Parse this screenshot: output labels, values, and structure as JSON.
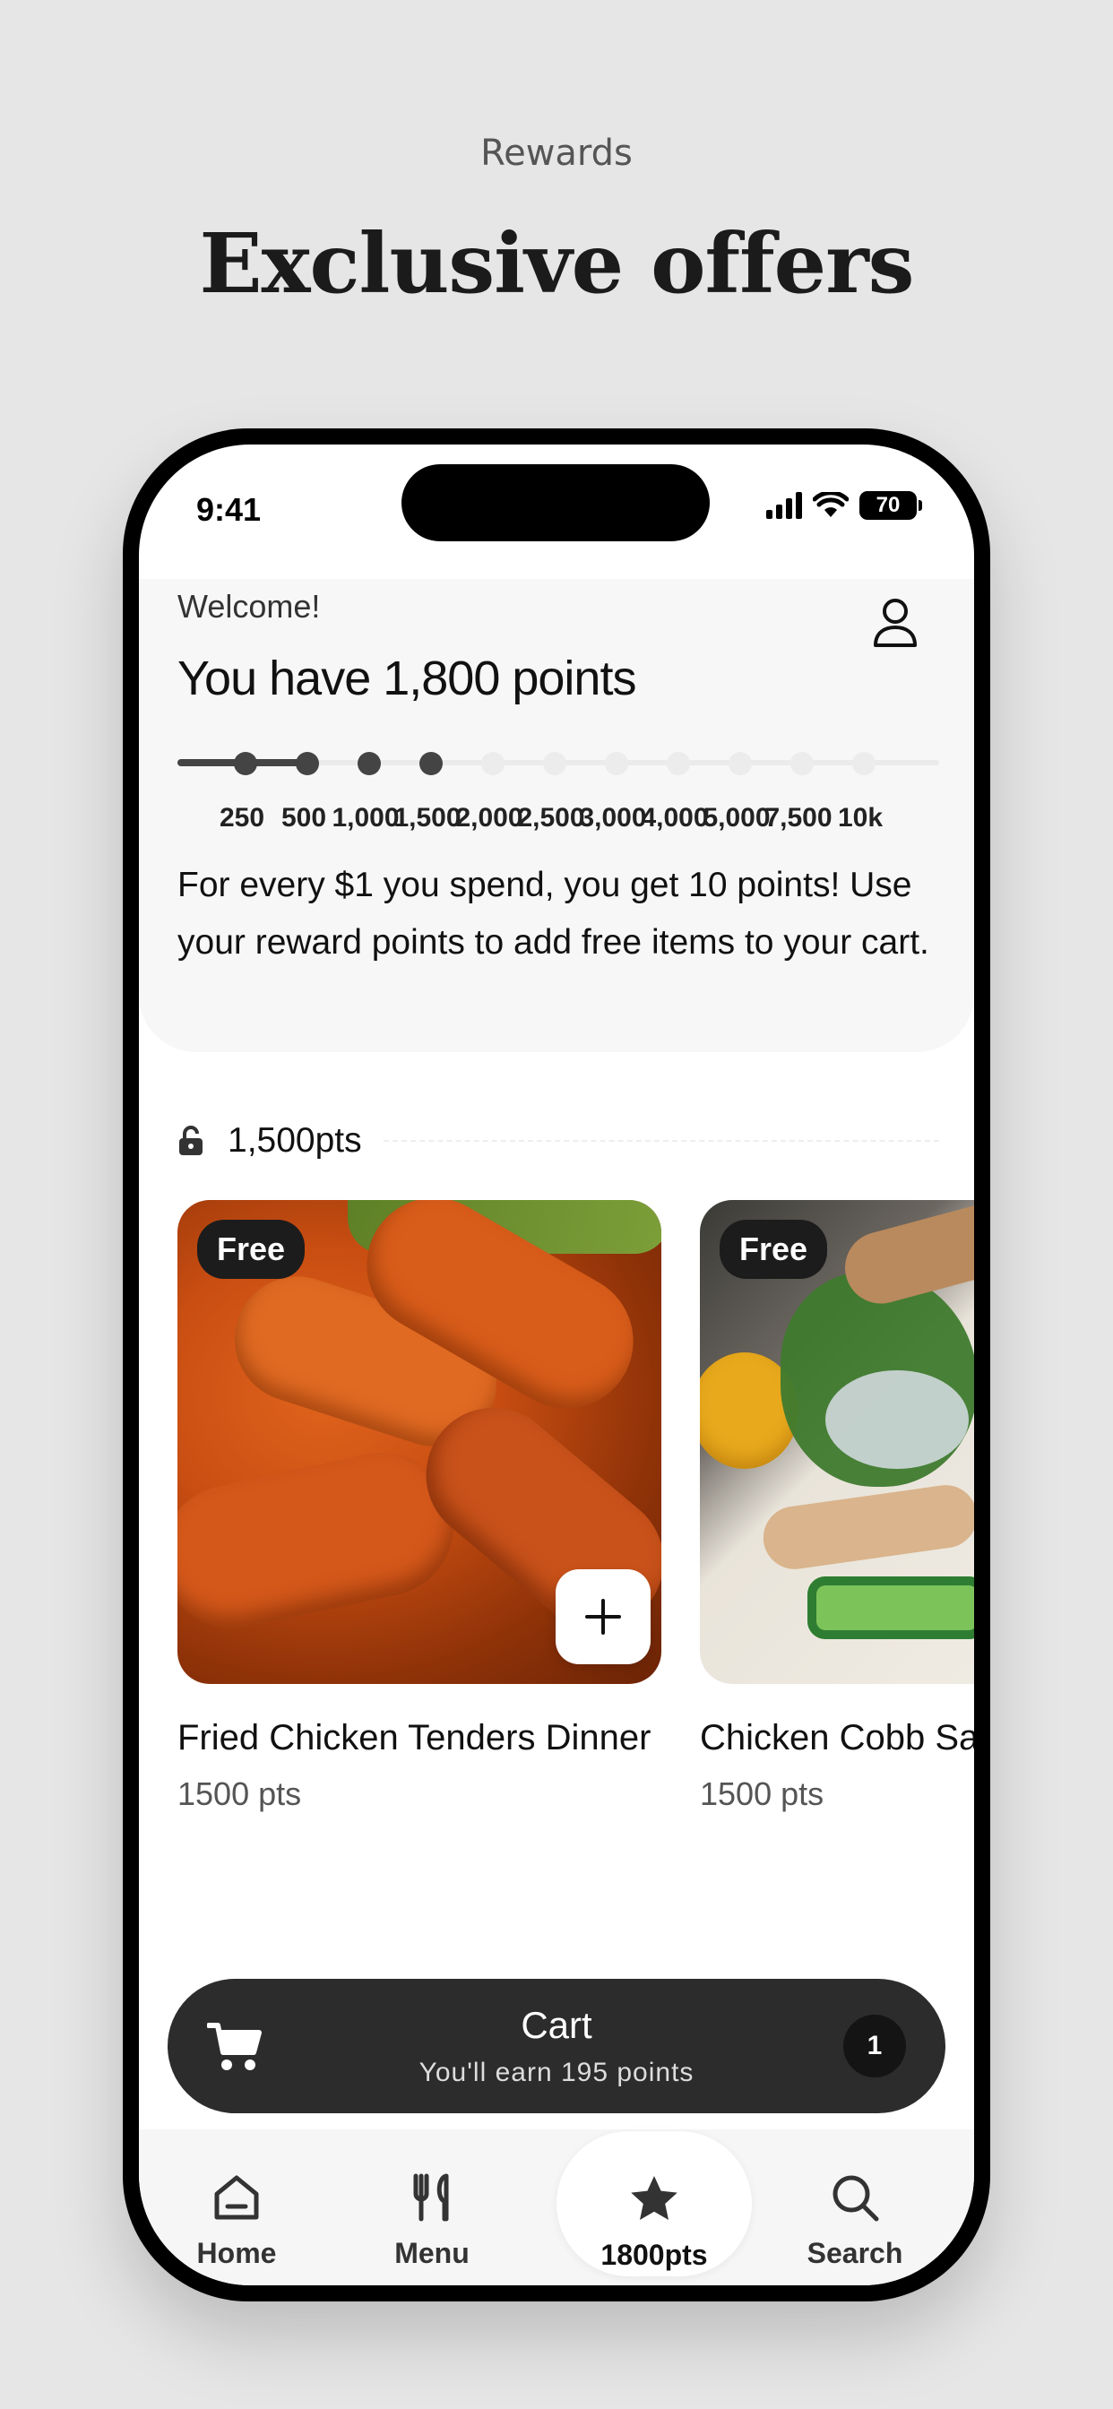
{
  "caption": "Rewards",
  "headline": "Exclusive offers",
  "status": {
    "time": "9:41",
    "battery": "70"
  },
  "header": {
    "welcome": "Welcome!",
    "points_text": "You have 1,800 points"
  },
  "progress": {
    "current_points": 1800,
    "milestones": [
      "250",
      "500",
      "1,000",
      "1,500",
      "2,000",
      "2,500",
      "3,000",
      "4,000",
      "5,000",
      "7,500",
      "10k"
    ],
    "reached_count": 4
  },
  "promo": "For every $1 you spend, you get 10 points! Use your reward points to add free items to your cart.",
  "tier": {
    "label": "1,500pts"
  },
  "items": [
    {
      "badge": "Free",
      "name": "Fried Chicken Tenders Dinner",
      "price": "1500 pts"
    },
    {
      "badge": "Free",
      "name": "Chicken Cobb Salad",
      "price": "1500 pts"
    }
  ],
  "cart": {
    "title": "Cart",
    "subtitle": "You'll earn 195 points",
    "count": "1"
  },
  "tabs": [
    {
      "label": "Home",
      "icon": "home-icon"
    },
    {
      "label": "Menu",
      "icon": "utensils-icon"
    },
    {
      "label": "1800pts",
      "icon": "star-icon"
    },
    {
      "label": "Search",
      "icon": "search-icon"
    }
  ]
}
